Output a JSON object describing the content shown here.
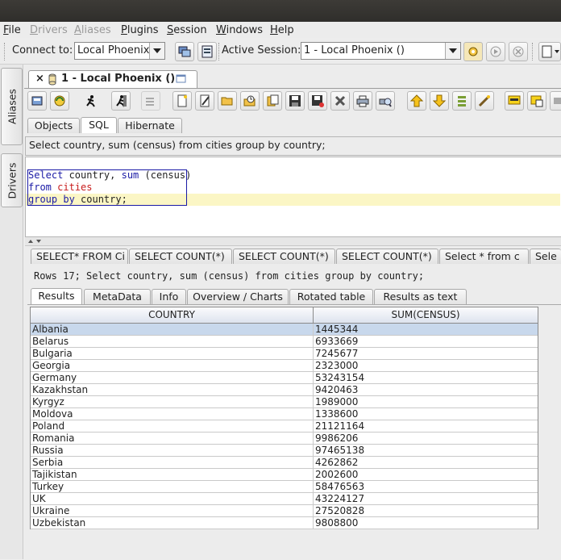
{
  "menu": [
    {
      "label": "File",
      "u": "F",
      "rest": "ile",
      "disabled": false
    },
    {
      "label": "Drivers",
      "u": "D",
      "rest": "rivers",
      "disabled": true
    },
    {
      "label": "Aliases",
      "u": "A",
      "rest": "liases",
      "disabled": true
    },
    {
      "label": "Plugins",
      "u": "P",
      "rest": "lugins",
      "disabled": false
    },
    {
      "label": "Session",
      "u": "S",
      "rest": "ession",
      "disabled": false
    },
    {
      "label": "Windows",
      "u": "W",
      "rest": "indows",
      "disabled": false
    },
    {
      "label": "Help",
      "u": "H",
      "rest": "elp",
      "disabled": false
    }
  ],
  "connbar": {
    "connect_label": "Connect to:",
    "connect_value": "Local Phoenix",
    "active_label": "Active Session:",
    "active_value": "1 - Local Phoenix ()"
  },
  "sidebar": {
    "aliases": "Aliases",
    "drivers": "Drivers"
  },
  "doc_tab": {
    "close": "×",
    "title": "1 - Local Phoenix ()"
  },
  "subtabs": [
    "Objects",
    "SQL",
    "Hibernate"
  ],
  "sql_comment": "Select country, sum (census) from cities group by country;",
  "editor": {
    "line1": {
      "kw1": "Select",
      "t1": " country, ",
      "kw2": "sum",
      "t2": " (census)"
    },
    "line2": {
      "kw": "from",
      "t": " ",
      "tbl": "cities"
    },
    "line3": {
      "kw": "group by",
      "t": " country;"
    }
  },
  "history_tabs": [
    "SELECT* FROM Ci",
    "SELECT COUNT(*)",
    "SELECT COUNT(*)",
    "SELECT COUNT(*)",
    "Select * from c",
    "Sele"
  ],
  "rows_info": "Rows 17;  Select country, sum (census) from cities group by country;",
  "result_tabs": [
    "Results",
    "MetaData",
    "Info",
    "Overview / Charts",
    "Rotated table",
    "Results as text"
  ],
  "table": {
    "columns": [
      "COUNTRY",
      "SUM(CENSUS)"
    ],
    "rows": [
      [
        "Albania",
        "1445344"
      ],
      [
        "Belarus",
        "6933669"
      ],
      [
        "Bulgaria",
        "7245677"
      ],
      [
        "Georgia",
        "2323000"
      ],
      [
        "Germany",
        "53243154"
      ],
      [
        "Kazakhstan",
        "9420463"
      ],
      [
        "Kyrgyz",
        "1989000"
      ],
      [
        "Moldova",
        "1338600"
      ],
      [
        "Poland",
        "21121164"
      ],
      [
        "Romania",
        "9986206"
      ],
      [
        "Russia",
        "97465138"
      ],
      [
        "Serbia",
        "4262862"
      ],
      [
        "Tajikistan",
        "2002600"
      ],
      [
        "Turkey",
        "58476563"
      ],
      [
        "UK",
        "43224127"
      ],
      [
        "Ukraine",
        "27520828"
      ],
      [
        "Uzbekistan",
        "9808800"
      ]
    ]
  }
}
